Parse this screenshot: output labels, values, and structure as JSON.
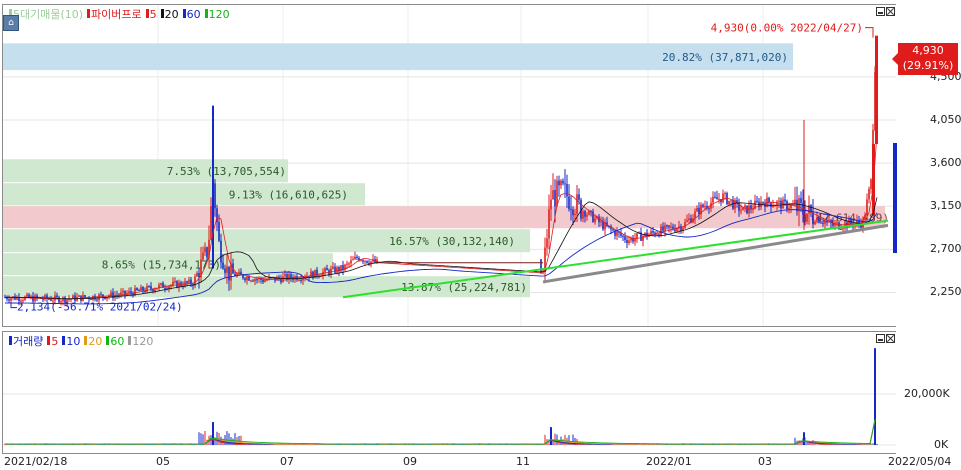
{
  "chart_data": [
    {
      "type": "candlestick",
      "legend": [
        {
          "label": "5대기매물(10)",
          "color": "#9bcf9b"
        },
        {
          "label": "파이버프로",
          "color": "#e01b1b"
        },
        {
          "label": "5",
          "color": "#e01b1b"
        },
        {
          "label": "20",
          "color": "#111111"
        },
        {
          "label": "60",
          "color": "#1428c8"
        },
        {
          "label": "120",
          "color": "#12b512"
        }
      ],
      "y_ticks": [
        "4,500",
        "4,050",
        "3,600",
        "3,150",
        "2,700",
        "2,250"
      ],
      "ylim": [
        1900,
        5250
      ],
      "y_tick_values": [
        4500,
        4050,
        3600,
        3150,
        2700,
        2250
      ],
      "x_dates": [
        "2021/02/18",
        "05",
        "07",
        "09",
        "11",
        "2022/01",
        "03",
        "2022/05/04"
      ],
      "current_price": {
        "label": "4,930",
        "change": "(29.91%)"
      },
      "annotations": [
        {
          "text": "4,930(0.00% 2022/04/27)",
          "color": "#e01b1b"
        },
        {
          "text": "2,134(-56.71% 2021/02/24)",
          "color": "#1428c8"
        }
      ],
      "volume_profile": [
        {
          "label": "20.82% (37,871,020)",
          "price_low": 4560,
          "price_high": 4850,
          "color": "#c6dfee"
        },
        {
          "label": "7.53% (13,705,554)",
          "price_low": 3390,
          "price_high": 3640,
          "color": "#cfe8cf"
        },
        {
          "label": "9.13% (16,610,625)",
          "price_low": 3150,
          "price_high": 3390,
          "color": "#cfe8cf"
        },
        {
          "label": "16.57% (30,132,140)",
          "price_low": 2660,
          "price_high": 2910,
          "color": "#cfe8cf"
        },
        {
          "label": "8.65% (15,734,173)",
          "price_low": 2420,
          "price_high": 2660,
          "color": "#cfe8cf"
        },
        {
          "label": "13.87% (25,224,781)",
          "price_low": 2190,
          "price_high": 2420,
          "color": "#cfe8cf"
        },
        {
          "label": "(42,614,489)",
          "price_low": 2910,
          "price_high": 3150,
          "color": "#f2c9cc"
        }
      ],
      "price_series_approx": [
        {
          "date": "2021/02/18",
          "close": 2200
        },
        {
          "date": "2021/03",
          "close": 2180
        },
        {
          "date": "2021/04",
          "close": 2250
        },
        {
          "date": "2021/05",
          "close": 2300
        },
        {
          "date": "2021/05/25",
          "close": 3400,
          "high": 4200
        },
        {
          "date": "2021/06",
          "close": 2400
        },
        {
          "date": "2021/07",
          "close": 2350
        },
        {
          "date": "2021/08",
          "close": 2550
        },
        {
          "date": "2021/11",
          "close": 2450
        },
        {
          "date": "2021/11/15",
          "close": 3250,
          "high": 3700
        },
        {
          "date": "2021/12",
          "close": 2850
        },
        {
          "date": "2022/01",
          "close": 2950
        },
        {
          "date": "2022/02",
          "close": 3200
        },
        {
          "date": "2022/03",
          "close": 3100
        },
        {
          "date": "2022/04",
          "close": 2950
        },
        {
          "date": "2022/04/27",
          "close": 4930
        }
      ]
    },
    {
      "type": "bar",
      "legend": [
        {
          "label": "거래량",
          "color": "#1428c8"
        },
        {
          "label": "5",
          "color": "#e01b1b"
        },
        {
          "label": "10",
          "color": "#1428c8"
        },
        {
          "label": "20",
          "color": "#e39a1a"
        },
        {
          "label": "60",
          "color": "#12b512"
        },
        {
          "label": "120",
          "color": "#999999"
        }
      ],
      "y_ticks": [
        "20,000K",
        "0K"
      ],
      "y_tick_values": [
        20000,
        0
      ],
      "ylim": [
        0,
        42000
      ],
      "spikes": [
        {
          "date": "2021/05/25",
          "value": 9000
        },
        {
          "date": "2021/11/15",
          "value": 7000
        },
        {
          "date": "2022/03/25",
          "value": 5000
        },
        {
          "date": "2022/04/27",
          "value": 38000
        }
      ]
    }
  ]
}
